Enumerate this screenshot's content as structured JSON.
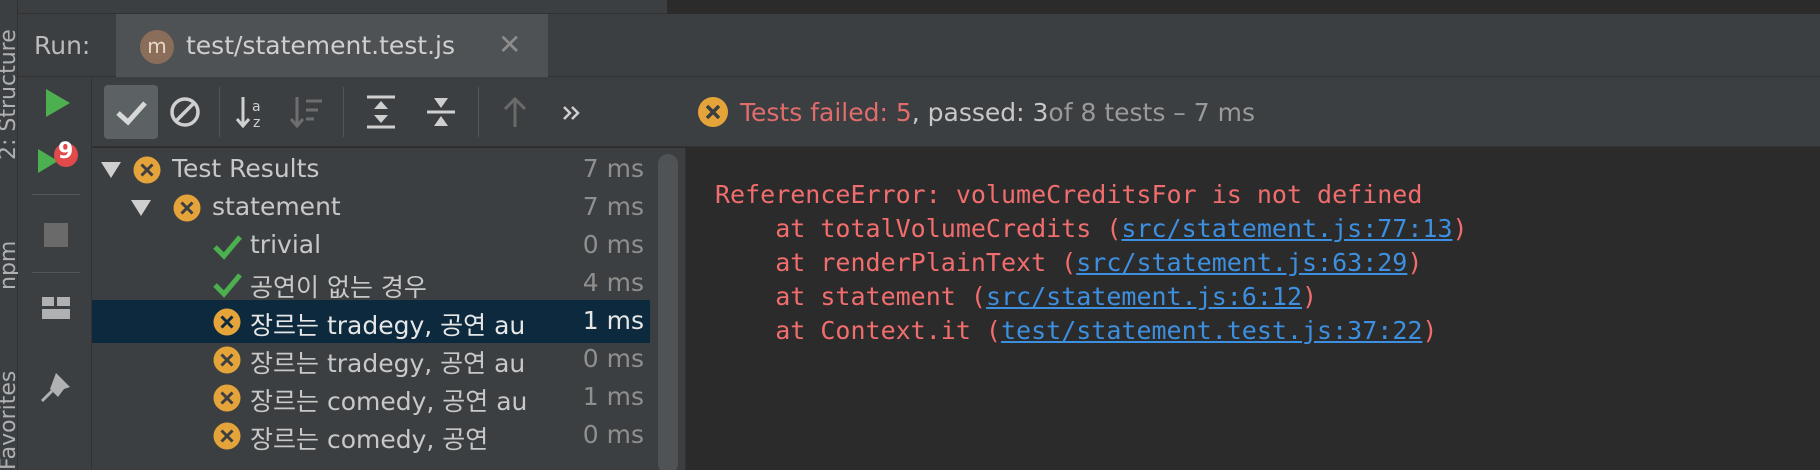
{
  "side_labels": [
    "2: Structure",
    "npm",
    "Favorites"
  ],
  "header": {
    "run_label": "Run:",
    "tab": {
      "icon_letter": "m",
      "title": "test/statement.test.js"
    }
  },
  "status": {
    "failed_label": "Tests failed: 5",
    "passed_label": ", passed: 3",
    "of_label": " of 8 tests – 7 ms"
  },
  "run_toolbar_badge": "9",
  "tree": {
    "rows": [
      {
        "label": "Test Results",
        "duration": "7 ms",
        "status": "fail"
      },
      {
        "label": "statement",
        "duration": "7 ms",
        "status": "fail"
      },
      {
        "label": "trivial",
        "duration": "0 ms",
        "status": "pass"
      },
      {
        "label": "공연이 없는 경우",
        "duration": "4 ms",
        "status": "pass"
      },
      {
        "label": "장르는 tradegy, 공연 au",
        "duration": "1 ms",
        "status": "fail"
      },
      {
        "label": "장르는 tradegy, 공연 au",
        "duration": "0 ms",
        "status": "fail"
      },
      {
        "label": "장르는 comedy, 공연 au",
        "duration": "1 ms",
        "status": "fail"
      },
      {
        "label": "장르는 comedy, 공연",
        "duration": "0 ms",
        "status": "fail"
      }
    ]
  },
  "console": {
    "error": "ReferenceError: volumeCreditsFor is not defined",
    "frames": [
      {
        "prefix": "    at totalVolumeCredits (",
        "link": "src/statement.js:77:13",
        "suffix": ")"
      },
      {
        "prefix": "    at renderPlainText (",
        "link": "src/statement.js:63:29",
        "suffix": ")"
      },
      {
        "prefix": "    at statement (",
        "link": "src/statement.js:6:12",
        "suffix": ")"
      },
      {
        "prefix": "    at Context.it (",
        "link": "test/statement.test.js:37:22",
        "suffix": ")"
      }
    ]
  },
  "colors": {
    "fail": "#e5a43a",
    "pass": "#4caf50",
    "run": "#4caf50",
    "error_text": "#f26d6d",
    "link": "#3d8fe0"
  }
}
